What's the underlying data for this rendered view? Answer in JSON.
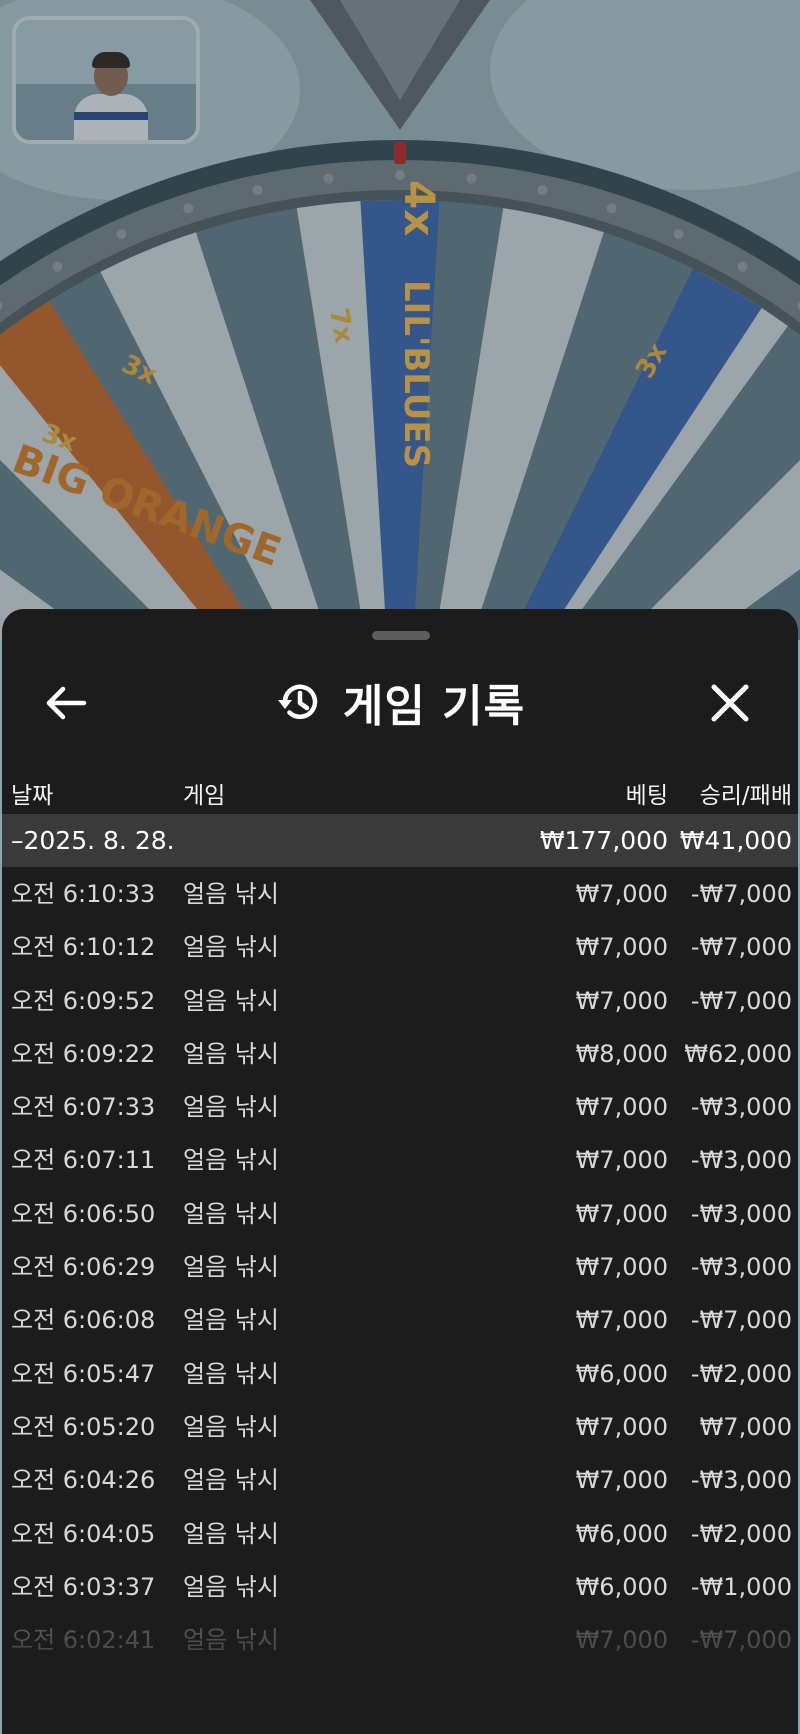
{
  "header": {
    "title": "게임 기록"
  },
  "table": {
    "columns": {
      "date": "날짜",
      "game": "게임",
      "bet": "베팅",
      "win_loss": "승리/패배"
    },
    "date_group": {
      "label": "–2025. 8. 28.",
      "total_bet": "₩177,000",
      "total_win_loss": "₩41,000"
    },
    "rows": [
      {
        "time": "오전 6:10:33",
        "game": "얼음 낚시",
        "bet": "₩7,000",
        "result": "-₩7,000"
      },
      {
        "time": "오전 6:10:12",
        "game": "얼음 낚시",
        "bet": "₩7,000",
        "result": "-₩7,000"
      },
      {
        "time": "오전 6:09:52",
        "game": "얼음 낚시",
        "bet": "₩7,000",
        "result": "-₩7,000"
      },
      {
        "time": "오전 6:09:22",
        "game": "얼음 낚시",
        "bet": "₩8,000",
        "result": "₩62,000"
      },
      {
        "time": "오전 6:07:33",
        "game": "얼음 낚시",
        "bet": "₩7,000",
        "result": "-₩3,000"
      },
      {
        "time": "오전 6:07:11",
        "game": "얼음 낚시",
        "bet": "₩7,000",
        "result": "-₩3,000"
      },
      {
        "time": "오전 6:06:50",
        "game": "얼음 낚시",
        "bet": "₩7,000",
        "result": "-₩3,000"
      },
      {
        "time": "오전 6:06:29",
        "game": "얼음 낚시",
        "bet": "₩7,000",
        "result": "-₩3,000"
      },
      {
        "time": "오전 6:06:08",
        "game": "얼음 낚시",
        "bet": "₩7,000",
        "result": "-₩7,000"
      },
      {
        "time": "오전 6:05:47",
        "game": "얼음 낚시",
        "bet": "₩6,000",
        "result": "-₩2,000"
      },
      {
        "time": "오전 6:05:20",
        "game": "얼음 낚시",
        "bet": "₩7,000",
        "result": "₩7,000"
      },
      {
        "time": "오전 6:04:26",
        "game": "얼음 낚시",
        "bet": "₩7,000",
        "result": "-₩3,000"
      },
      {
        "time": "오전 6:04:05",
        "game": "얼음 낚시",
        "bet": "₩6,000",
        "result": "-₩2,000"
      },
      {
        "time": "오전 6:03:37",
        "game": "얼음 낚시",
        "bet": "₩6,000",
        "result": "-₩1,000"
      },
      {
        "time": "오전 6:02:41",
        "game": "얼음 낚시",
        "bet": "₩7,000",
        "result": "-₩7,000"
      }
    ]
  },
  "wheel": {
    "segments_left": [
      "3x",
      "3x",
      "7x"
    ],
    "segments_right": [
      "3x"
    ],
    "bonus_labels": [
      "4x",
      "LIL'BLUES",
      "BIG ORANGE"
    ]
  },
  "icons": {
    "back": "arrow-left-icon",
    "history": "history-clock-icon",
    "close": "close-x-icon"
  },
  "colors": {
    "sheet_bg": "#1c1c1c",
    "group_row_bg": "#3a3a3a",
    "text_primary": "#ffffff",
    "text_row": "#d9d9d9"
  }
}
